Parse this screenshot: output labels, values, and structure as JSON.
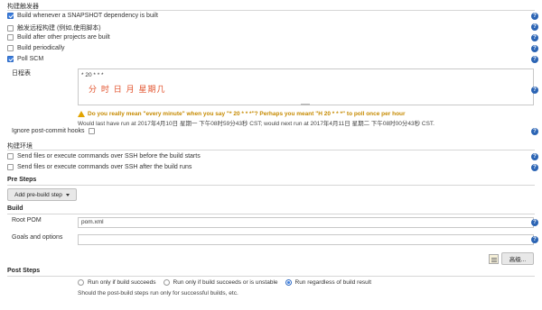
{
  "build_triggers": {
    "title": "构建触发器",
    "options": [
      {
        "label": "Build whenever a SNAPSHOT dependency is built",
        "checked": true
      },
      {
        "label": "触发远程构建 (例如,使用脚本)",
        "checked": false
      },
      {
        "label": "Build after other projects are built",
        "checked": false
      },
      {
        "label": "Build periodically",
        "checked": false
      },
      {
        "label": "Poll SCM",
        "checked": true
      }
    ],
    "schedule_label": "日程表",
    "schedule_value": "* 20 * * *",
    "schedule_annotation": "分 时 日 月 星期几",
    "warning": "Do you really mean \"every minute\" when you say \"* 20 * * *\"? Perhaps you meant \"H 20 * * *\" to poll once per hour",
    "run_info": "Would last have run at 2017年4月10日 星期一 下午08时59分43秒 CST; would next run at 2017年4月11日 星期二 下午08时00分43秒 CST.",
    "ignore_hooks_label": "Ignore post-commit hooks",
    "ignore_hooks_checked": false
  },
  "build_env": {
    "title": "构建环境",
    "options": [
      {
        "label": "Send files or execute commands over SSH before the build starts",
        "checked": false
      },
      {
        "label": "Send files or execute commands over SSH after the build runs",
        "checked": false
      }
    ]
  },
  "pre_steps": {
    "title": "Pre Steps",
    "add_button": "Add pre-build step"
  },
  "build": {
    "title": "Build",
    "root_pom_label": "Root POM",
    "root_pom_value": "pom.xml",
    "goals_label": "Goals and options",
    "goals_value": "",
    "advanced_button": "高级..."
  },
  "post_steps": {
    "title": "Post Steps",
    "radios": [
      {
        "label": "Run only if build succeeds",
        "selected": false
      },
      {
        "label": "Run only if build succeeds or is unstable",
        "selected": false
      },
      {
        "label": "Run regardless of build result",
        "selected": true
      }
    ],
    "note": "Should the post-build steps run only for successful builds, etc."
  },
  "help_icon_glyph": "?",
  "colors": {
    "accent": "#3b7ddd",
    "help": "#2b64b4",
    "warning": "#c68a00",
    "annotation": "#e2502a"
  }
}
